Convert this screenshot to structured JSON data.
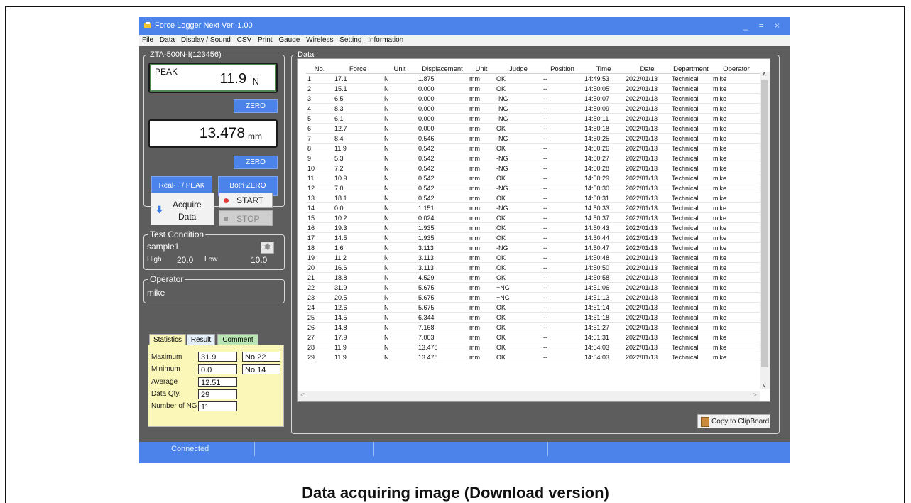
{
  "window": {
    "title": "Force Logger Next Ver. 1.00",
    "controls": "_ = ×"
  },
  "menu": [
    "File",
    "Data",
    "Display / Sound",
    "CSV",
    "Print",
    "Gauge",
    "Wireless",
    "Setting",
    "Information"
  ],
  "gauge": {
    "group_label": "ZTA-500N-I(123456)",
    "force_mode": "PEAK",
    "force_value": "11.9",
    "force_unit": "N",
    "zero_label": "ZERO",
    "displacement_value": "13.478",
    "displacement_unit": "mm",
    "zero2_label": "ZERO",
    "realt_peak_label": "Real-T / PEAK",
    "both_zero_label": "Both ZERO"
  },
  "acquire": {
    "line1": "Acquire",
    "line2": "Data",
    "start_label": "START",
    "stop_label": "STOP"
  },
  "test_condition": {
    "label": "Test Condition",
    "name": "sample1",
    "high_label": "High",
    "high_value": "20.0",
    "low_label": "Low",
    "low_value": "10.0"
  },
  "operator": {
    "label": "Operator",
    "name": "mike"
  },
  "stats": {
    "tabs": [
      "Statistics",
      "Result",
      "Comment"
    ],
    "max_label": "Maximum",
    "max_value": "31.9",
    "max_no": "No.22",
    "min_label": "Minimum",
    "min_value": "0.0",
    "min_no": "No.14",
    "avg_label": "Average",
    "avg_value": "12.51",
    "qty_label": "Data Qty.",
    "qty_value": "29",
    "ng_label": "Number of NG",
    "ng_value": "11"
  },
  "data": {
    "group_label": "Data",
    "columns": [
      "No.",
      "Force",
      "Unit",
      "Displacement",
      "Unit",
      "Judge",
      "Position",
      "Time",
      "Date",
      "Department",
      "Operator"
    ],
    "rows": [
      [
        "1",
        "17.1",
        "N",
        "1.875",
        "mm",
        "OK",
        "--",
        "14:49:53",
        "2022/01/13",
        "Technical",
        "mike"
      ],
      [
        "2",
        "15.1",
        "N",
        "0.000",
        "mm",
        "OK",
        "--",
        "14:50:05",
        "2022/01/13",
        "Technical",
        "mike"
      ],
      [
        "3",
        "6.5",
        "N",
        "0.000",
        "mm",
        "-NG",
        "--",
        "14:50:07",
        "2022/01/13",
        "Technical",
        "mike"
      ],
      [
        "4",
        "8.3",
        "N",
        "0.000",
        "mm",
        "-NG",
        "--",
        "14:50:09",
        "2022/01/13",
        "Technical",
        "mike"
      ],
      [
        "5",
        "6.1",
        "N",
        "0.000",
        "mm",
        "-NG",
        "--",
        "14:50:11",
        "2022/01/13",
        "Technical",
        "mike"
      ],
      [
        "6",
        "12.7",
        "N",
        "0.000",
        "mm",
        "OK",
        "--",
        "14:50:18",
        "2022/01/13",
        "Technical",
        "mike"
      ],
      [
        "7",
        "8.4",
        "N",
        "0.546",
        "mm",
        "-NG",
        "--",
        "14:50:25",
        "2022/01/13",
        "Technical",
        "mike"
      ],
      [
        "8",
        "11.9",
        "N",
        "0.542",
        "mm",
        "OK",
        "--",
        "14:50:26",
        "2022/01/13",
        "Technical",
        "mike"
      ],
      [
        "9",
        "5.3",
        "N",
        "0.542",
        "mm",
        "-NG",
        "--",
        "14:50:27",
        "2022/01/13",
        "Technical",
        "mike"
      ],
      [
        "10",
        "7.2",
        "N",
        "0.542",
        "mm",
        "-NG",
        "--",
        "14:50:28",
        "2022/01/13",
        "Technical",
        "mike"
      ],
      [
        "11",
        "10.9",
        "N",
        "0.542",
        "mm",
        "OK",
        "--",
        "14:50:29",
        "2022/01/13",
        "Technical",
        "mike"
      ],
      [
        "12",
        "7.0",
        "N",
        "0.542",
        "mm",
        "-NG",
        "--",
        "14:50:30",
        "2022/01/13",
        "Technical",
        "mike"
      ],
      [
        "13",
        "18.1",
        "N",
        "0.542",
        "mm",
        "OK",
        "--",
        "14:50:31",
        "2022/01/13",
        "Technical",
        "mike"
      ],
      [
        "14",
        "0.0",
        "N",
        "1.151",
        "mm",
        "-NG",
        "--",
        "14:50:33",
        "2022/01/13",
        "Technical",
        "mike"
      ],
      [
        "15",
        "10.2",
        "N",
        "0.024",
        "mm",
        "OK",
        "--",
        "14:50:37",
        "2022/01/13",
        "Technical",
        "mike"
      ],
      [
        "16",
        "19.3",
        "N",
        "1.935",
        "mm",
        "OK",
        "--",
        "14:50:43",
        "2022/01/13",
        "Technical",
        "mike"
      ],
      [
        "17",
        "14.5",
        "N",
        "1.935",
        "mm",
        "OK",
        "--",
        "14:50:44",
        "2022/01/13",
        "Technical",
        "mike"
      ],
      [
        "18",
        "1.6",
        "N",
        "3.113",
        "mm",
        "-NG",
        "--",
        "14:50:47",
        "2022/01/13",
        "Technical",
        "mike"
      ],
      [
        "19",
        "11.2",
        "N",
        "3.113",
        "mm",
        "OK",
        "--",
        "14:50:48",
        "2022/01/13",
        "Technical",
        "mike"
      ],
      [
        "20",
        "16.6",
        "N",
        "3.113",
        "mm",
        "OK",
        "--",
        "14:50:50",
        "2022/01/13",
        "Technical",
        "mike"
      ],
      [
        "21",
        "18.8",
        "N",
        "4.529",
        "mm",
        "OK",
        "--",
        "14:50:58",
        "2022/01/13",
        "Technical",
        "mike"
      ],
      [
        "22",
        "31.9",
        "N",
        "5.675",
        "mm",
        "+NG",
        "--",
        "14:51:06",
        "2022/01/13",
        "Technical",
        "mike"
      ],
      [
        "23",
        "20.5",
        "N",
        "5.675",
        "mm",
        "+NG",
        "--",
        "14:51:13",
        "2022/01/13",
        "Technical",
        "mike"
      ],
      [
        "24",
        "12.6",
        "N",
        "5.675",
        "mm",
        "OK",
        "--",
        "14:51:14",
        "2022/01/13",
        "Technical",
        "mike"
      ],
      [
        "25",
        "14.5",
        "N",
        "6.344",
        "mm",
        "OK",
        "--",
        "14:51:18",
        "2022/01/13",
        "Technical",
        "mike"
      ],
      [
        "26",
        "14.8",
        "N",
        "7.168",
        "mm",
        "OK",
        "--",
        "14:51:27",
        "2022/01/13",
        "Technical",
        "mike"
      ],
      [
        "27",
        "17.9",
        "N",
        "7.003",
        "mm",
        "OK",
        "--",
        "14:51:31",
        "2022/01/13",
        "Technical",
        "mike"
      ],
      [
        "28",
        "11.9",
        "N",
        "13.478",
        "mm",
        "OK",
        "--",
        "14:54:03",
        "2022/01/13",
        "Technical",
        "mike"
      ],
      [
        "29",
        "11.9",
        "N",
        "13.478",
        "mm",
        "OK",
        "--",
        "14:54:03",
        "2022/01/13",
        "Technical",
        "mike"
      ]
    ],
    "copy_label": "Copy to ClipBoard"
  },
  "status": {
    "connection": "Connected"
  },
  "caption": "Data acquiring image (Download version)",
  "colors": {
    "accent": "#4b83ea",
    "ok": "#1b9a1b",
    "ng": "#d42020",
    "panel_bg": "#5d5d5d",
    "stats_bg": "#fbf7b8"
  }
}
